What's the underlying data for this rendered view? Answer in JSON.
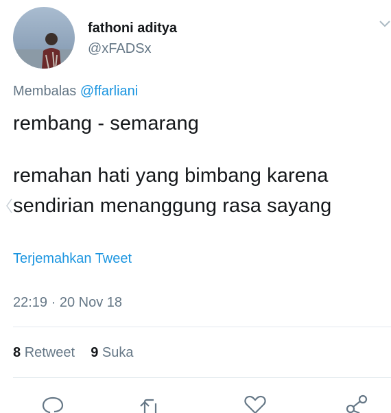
{
  "author": {
    "display_name": "fathoni aditya",
    "handle": "@xFADSx"
  },
  "reply": {
    "prefix": "Membalas",
    "handle": "@ffarliani"
  },
  "tweet": {
    "lines": [
      "rembang - semarang",
      "remahan hati yang bimbang karena",
      "sendirian menanggung rasa sayang"
    ]
  },
  "translate_label": "Terjemahkan Tweet",
  "timestamp": "22:19 · 20 Nov 18",
  "stats": {
    "retweet_count": "8",
    "retweet_label": "Retweet",
    "like_count": "9",
    "like_label": "Suka"
  },
  "icons": {
    "actions": [
      "reply-icon",
      "retweet-icon",
      "like-icon",
      "share-icon"
    ]
  },
  "colors": {
    "link": "#1b95e0",
    "secondary_text": "#657786",
    "primary_text": "#14171a"
  }
}
